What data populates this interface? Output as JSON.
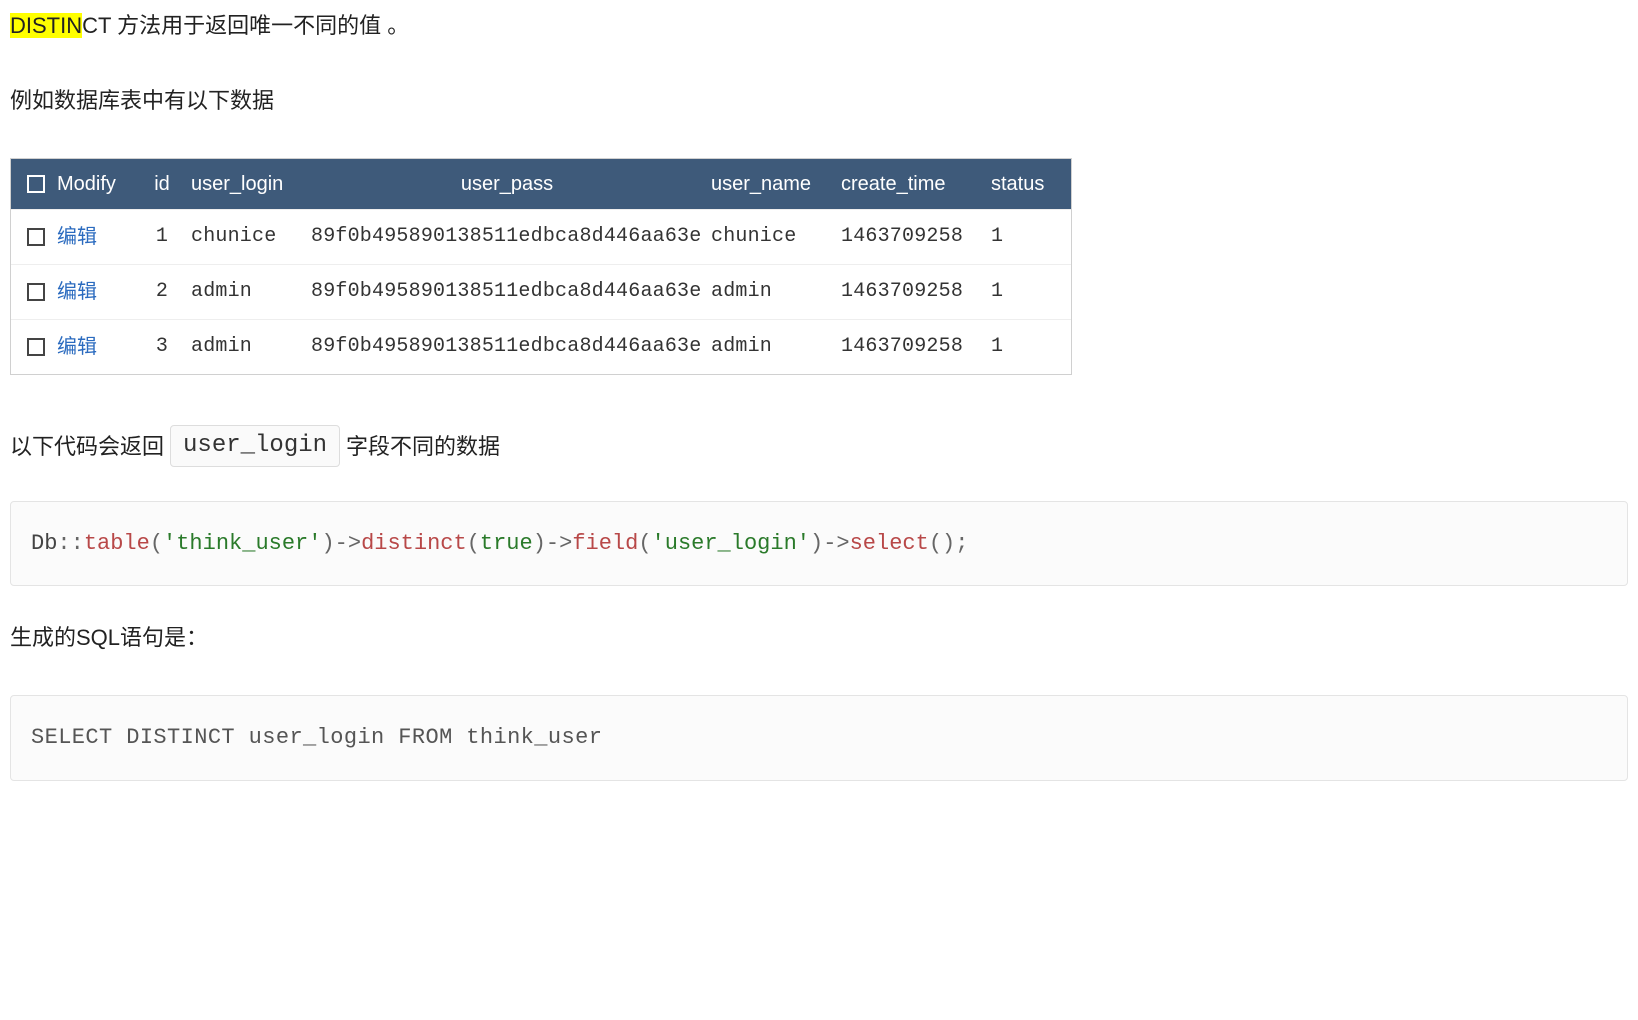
{
  "intro": {
    "highlighted": "DISTIN",
    "rest": "CT 方法用于返回唯一不同的值 。"
  },
  "para_before_table": "例如数据库表中有以下数据",
  "table": {
    "headers": {
      "modify": "Modify",
      "id": "id",
      "user_login": "user_login",
      "user_pass": "user_pass",
      "user_name": "user_name",
      "create_time": "create_time",
      "status": "status"
    },
    "edit_label": "编辑",
    "rows": [
      {
        "id": "1",
        "user_login": "chunice",
        "user_pass": "89f0b495890138511edbca8d446aa63e",
        "user_name": "chunice",
        "create_time": "1463709258",
        "status": "1"
      },
      {
        "id": "2",
        "user_login": "admin",
        "user_pass": "89f0b495890138511edbca8d446aa63e",
        "user_name": "admin",
        "create_time": "1463709258",
        "status": "1"
      },
      {
        "id": "3",
        "user_login": "admin",
        "user_pass": "89f0b495890138511edbca8d446aa63e",
        "user_name": "admin",
        "create_time": "1463709258",
        "status": "1"
      }
    ]
  },
  "para_code_intro_pre": "以下代码会返回",
  "para_code_intro_inline": "user_login",
  "para_code_intro_post": "字段不同的数据",
  "code1": {
    "db": "Db",
    "scope": "::",
    "m_table": "table",
    "s_table": "'think_user'",
    "arrow": "->",
    "m_distinct": "distinct",
    "b_true": "true",
    "m_field": "field",
    "s_field": "'user_login'",
    "m_select": "select",
    "paren_o": "(",
    "paren_c": ")",
    "semi": ";"
  },
  "para_sql_intro": "生成的SQL语句是：",
  "code2": "SELECT DISTINCT user_login FROM think_user"
}
